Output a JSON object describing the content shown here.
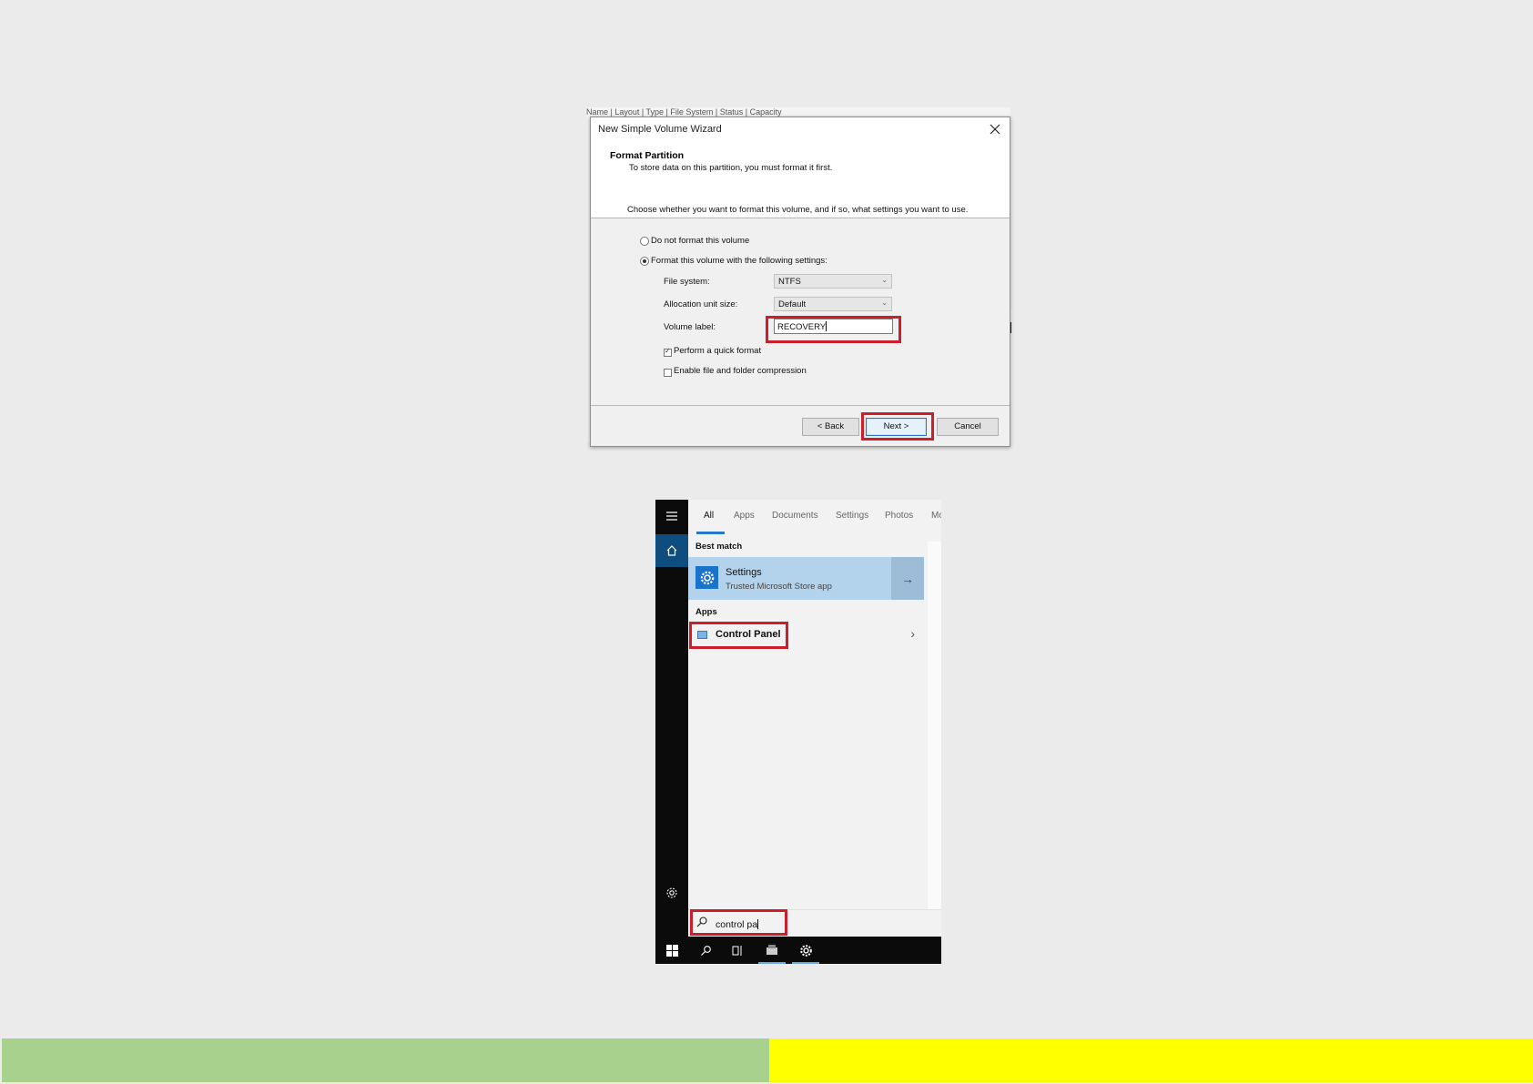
{
  "wizard": {
    "title": "New Simple Volume Wizard",
    "header_title": "Format Partition",
    "header_subtitle": "To store data on this partition, you must format it first.",
    "instruction": "Choose whether you want to format this volume, and if so, what settings you want to use.",
    "option_no_format": "Do not format this volume",
    "option_format": "Format this volume with the following settings:",
    "selected_option": "format",
    "file_system_label": "File system:",
    "file_system_value": "NTFS",
    "allocation_label": "Allocation unit size:",
    "allocation_value": "Default",
    "volume_label_label": "Volume label:",
    "volume_label_value": "RECOVERY",
    "quick_format_label": "Perform a quick format",
    "quick_format_checked": true,
    "compression_label": "Enable file and folder compression",
    "compression_checked": false,
    "back_button": "< Back",
    "next_button": "Next >",
    "cancel_button": "Cancel",
    "background_window_header": "Name | Layout | Type | File System | Status | Capacity"
  },
  "start_menu": {
    "tabs": [
      "All",
      "Apps",
      "Documents",
      "Settings",
      "Photos",
      "Mo"
    ],
    "active_tab": "All",
    "best_match_heading": "Best match",
    "best_match_name": "Settings",
    "best_match_subtitle": "Trusted Microsoft Store app",
    "apps_heading": "Apps",
    "app_result": "Control Panel",
    "search_text": "control pa"
  },
  "highlight_color": "#cc1f2c",
  "accent_color": "#1a73ca",
  "bottom_bars": {
    "left_color": "#a9d18e",
    "right_color": "#ffff00"
  }
}
